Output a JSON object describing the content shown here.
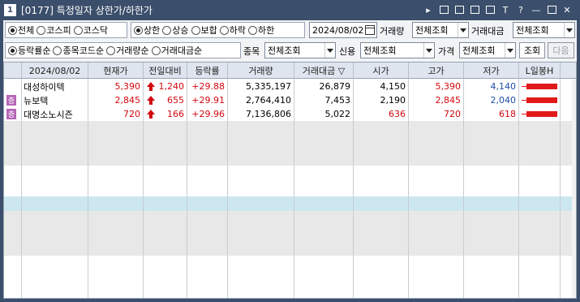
{
  "window": {
    "num": "1",
    "title": "[0177] 특정일자 상한가/하한가"
  },
  "filters": {
    "market_options": [
      {
        "label": "전체",
        "selected": true
      },
      {
        "label": "코스피",
        "selected": false
      },
      {
        "label": "코스닥",
        "selected": false
      }
    ],
    "limit_options": [
      {
        "label": "상한",
        "selected": true
      },
      {
        "label": "상승",
        "selected": false
      },
      {
        "label": "보합",
        "selected": false
      },
      {
        "label": "하락",
        "selected": false
      },
      {
        "label": "하한",
        "selected": false
      }
    ],
    "date": "2024/08/02",
    "volume_label": "거래량",
    "volume_value": "전체조회",
    "amount_label": "거래대금",
    "amount_value": "전체조회",
    "sort_options": [
      {
        "label": "등락률순",
        "selected": true
      },
      {
        "label": "종목코드순",
        "selected": false
      },
      {
        "label": "거래량순",
        "selected": false
      },
      {
        "label": "거래대금순",
        "selected": false
      }
    ],
    "item_label": "종목",
    "item_value": "전체조회",
    "credit_label": "신용",
    "credit_value": "전체조회",
    "price_label": "가격",
    "price_value": "전체조회",
    "search_button": "조회",
    "next_button": "다음"
  },
  "table": {
    "headers": [
      "2024/08/02",
      "현재가",
      "전일대비",
      "등락률",
      "거래량",
      "거래대금 ▽",
      "시가",
      "고가",
      "저가",
      "L일봉H"
    ],
    "rows": [
      {
        "name": "대성하이텍",
        "badge": "",
        "price": "5,390",
        "change": "1,240",
        "rate": "+29.88",
        "volume": "5,335,197",
        "amount": "26,879",
        "open": "4,150",
        "high": "5,390",
        "low": "4,140",
        "price_color": "red",
        "open_color": "black",
        "high_color": "red",
        "low_color": "blue"
      },
      {
        "name": "뉴보텍",
        "badge": "증",
        "price": "2,845",
        "change": "655",
        "rate": "+29.91",
        "volume": "2,764,410",
        "amount": "7,453",
        "open": "2,190",
        "high": "2,845",
        "low": "2,040",
        "price_color": "red",
        "open_color": "black",
        "high_color": "red",
        "low_color": "blue"
      },
      {
        "name": "대명소노시즌",
        "badge": "증",
        "price": "720",
        "change": "166",
        "rate": "+29.96",
        "volume": "7,136,806",
        "amount": "5,022",
        "open": "636",
        "high": "720",
        "low": "618",
        "price_color": "red",
        "open_color": "red",
        "high_color": "red",
        "low_color": "red"
      }
    ]
  },
  "colors": {
    "titlebar": "#3b4e6b",
    "up": "#d3070f",
    "down": "#1f4ea8",
    "badge": "#b565b6"
  }
}
